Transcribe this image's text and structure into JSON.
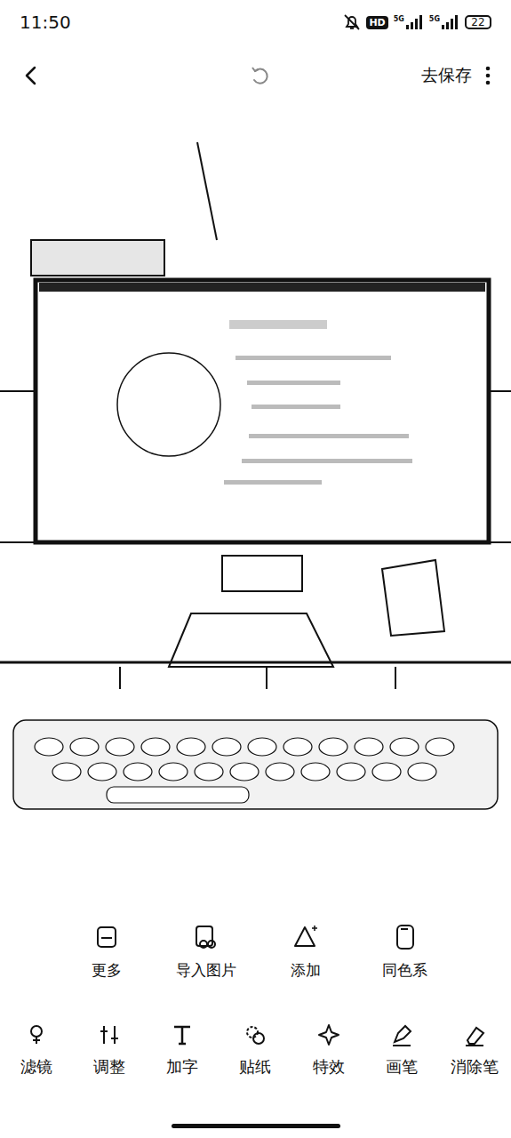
{
  "status_bar": {
    "time": "11:50",
    "hd": "HD",
    "networks": [
      "5G",
      "5G"
    ],
    "battery": "22"
  },
  "header": {
    "action": "去保存"
  },
  "tools_primary": [
    {
      "label": "更多"
    },
    {
      "label": "导入图片"
    },
    {
      "label": "添加"
    },
    {
      "label": "同色系"
    }
  ],
  "tools_secondary": [
    {
      "label": "滤镜"
    },
    {
      "label": "调整"
    },
    {
      "label": "加字"
    },
    {
      "label": "贴纸"
    },
    {
      "label": "特效"
    },
    {
      "label": "画笔"
    },
    {
      "label": "消除笔"
    }
  ]
}
